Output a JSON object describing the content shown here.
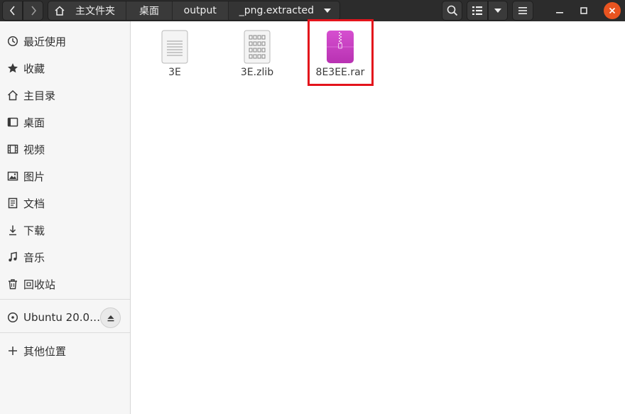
{
  "header": {
    "breadcrumbs": [
      "主文件夹",
      "桌面",
      "output",
      "_png.extracted"
    ]
  },
  "sidebar": {
    "items": [
      {
        "label": "最近使用",
        "icon": "clock-icon"
      },
      {
        "label": "收藏",
        "icon": "star-icon"
      },
      {
        "label": "主目录",
        "icon": "home-icon"
      },
      {
        "label": "桌面",
        "icon": "desktop-icon"
      },
      {
        "label": "视频",
        "icon": "video-icon"
      },
      {
        "label": "图片",
        "icon": "picture-icon"
      },
      {
        "label": "文档",
        "icon": "document-icon"
      },
      {
        "label": "下载",
        "icon": "download-icon"
      },
      {
        "label": "音乐",
        "icon": "music-icon"
      },
      {
        "label": "回收站",
        "icon": "trash-icon"
      }
    ],
    "devices": [
      {
        "label": "Ubuntu 20.0…",
        "icon": "disc-icon"
      }
    ],
    "other": {
      "label": "其他位置",
      "icon": "plus-icon"
    }
  },
  "files": [
    {
      "name": "3E",
      "icon": "text-file-icon"
    },
    {
      "name": "3E.zlib",
      "icon": "binary-file-icon"
    },
    {
      "name": "8E3EE.rar",
      "icon": "archive-file-icon"
    }
  ],
  "colors": {
    "headerbar": "#2c2c2c",
    "close_button": "#e95420",
    "archive_icon": "#c840c0",
    "highlight_box": "#e3141c"
  }
}
